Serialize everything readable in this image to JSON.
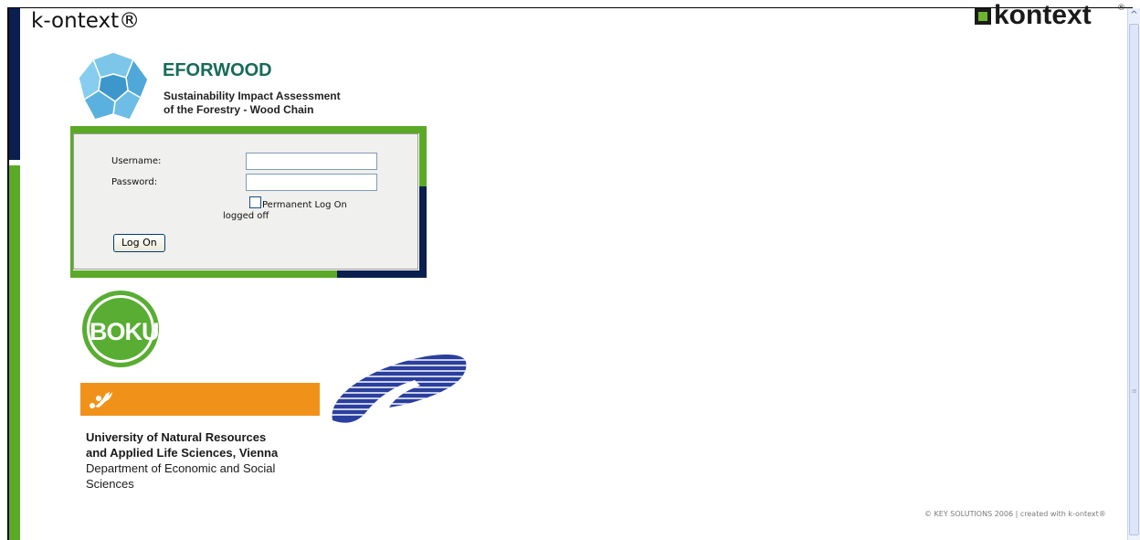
{
  "header": {
    "app_title": "k-ontext®",
    "brand_logo_text": "kontext",
    "brand_logo_mark": "®"
  },
  "project": {
    "name": "EFORWOOD",
    "subtitle_line1": "Sustainability Impact Assessment",
    "subtitle_line2": "of the Forestry - Wood Chain"
  },
  "login": {
    "username_label": "Username:",
    "username_value": "",
    "password_label": "Password:",
    "password_value": "",
    "permanent_label": "Permanent Log On",
    "permanent_checked": false,
    "status_text": "logged off",
    "submit_label": "Log On"
  },
  "partner": {
    "logo_text": "BOKU",
    "name_line1": "University of Natural Resources",
    "name_line2": "and Applied Life Sciences, Vienna",
    "department": "Department of Economic and Social Sciences"
  },
  "footer": {
    "copyright": "© KEY SOLUTIONS 2006 | created with k-ontext®"
  },
  "scrollbar": {
    "up_arrow": "^"
  },
  "colors": {
    "navy": "#0b1f4f",
    "green": "#5aaa28",
    "eforwood_teal": "#176b59",
    "boku_orange": "#f0921a"
  }
}
